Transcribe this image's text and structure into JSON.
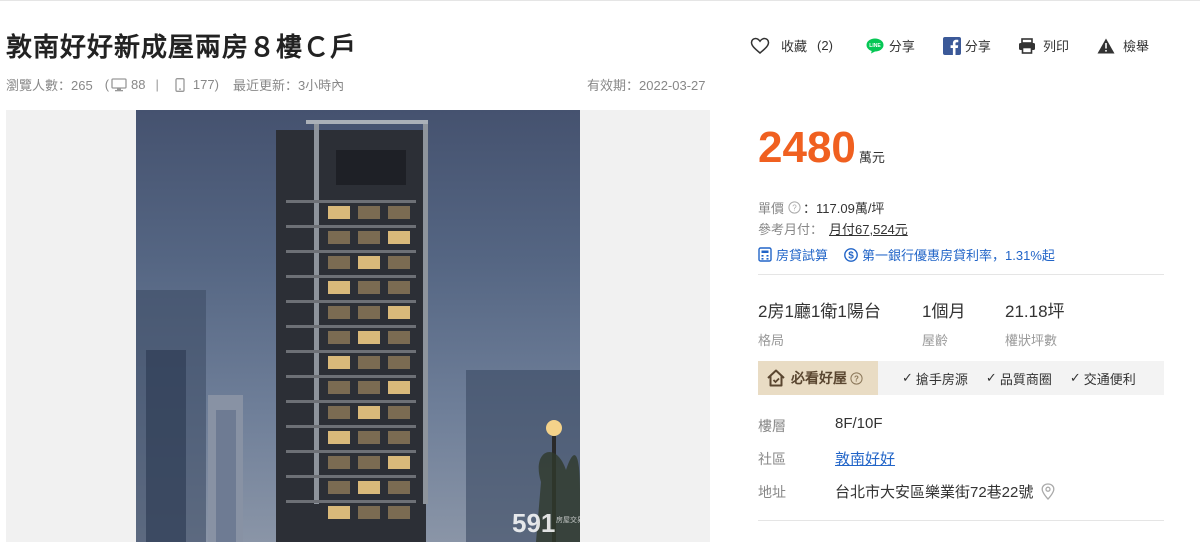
{
  "title": "敦南好好新成屋兩房８樓Ｃ戶",
  "actions": {
    "favorite_label": "收藏",
    "favorite_count": "(2)",
    "line_share_label": "分享",
    "fb_share_label": "分享",
    "print_label": "列印",
    "report_label": "檢舉"
  },
  "stats": {
    "views_label": "瀏覽人數：265",
    "desktop_open": "(",
    "desktop_count": "88",
    "separator": "|",
    "mobile_count": "177)",
    "updated": "最近更新：3小時內"
  },
  "expiry": "有效期：2022-03-27",
  "photo": {
    "watermark_number": "591",
    "watermark_text": "房屋交易"
  },
  "price": {
    "value": "2480",
    "unit": "萬元"
  },
  "unit_price": {
    "label": "單價",
    "value": "：117.09萬/坪"
  },
  "monthly": {
    "label": "參考月付：",
    "value": "月付67,524元"
  },
  "links": {
    "mortgage_calc": "房貸試算",
    "bank_offer": "第一銀行優惠房貸利率，1.31%起"
  },
  "specs": [
    {
      "value": "2房1廳1衛1陽台",
      "label": "格局"
    },
    {
      "value": "1個月",
      "label": "屋齡"
    },
    {
      "value": "21.18坪",
      "label": "權狀坪數"
    }
  ],
  "must_see": {
    "label": "必看好屋",
    "checks": [
      "搶手房源",
      "品質商圈",
      "交通便利"
    ]
  },
  "info": {
    "floor_label": "樓層",
    "floor_value": "8F/10F",
    "community_label": "社區",
    "community_value": "敦南好好",
    "address_label": "地址",
    "address_value": "台北市大安區樂業街72巷22號"
  },
  "colors": {
    "price": "#f06020",
    "link": "#2265c8",
    "must_tag_bg": "#e9dcc4",
    "line_green": "#06c755",
    "facebook_blue": "#3b5998"
  }
}
